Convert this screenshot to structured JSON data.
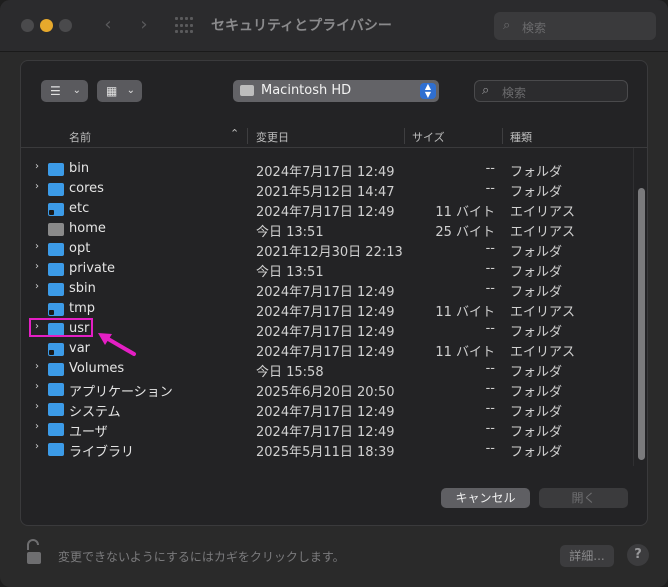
{
  "window": {
    "title": "セキュリティとプライバシー",
    "search_placeholder": "検索",
    "back_icon": "chevron-left-icon",
    "forward_icon": "chevron-right-icon",
    "bottom_text": "変更できないようにするにはカギをクリックします。",
    "detail_button": "詳細...",
    "help_button": "?"
  },
  "sheet": {
    "location": "Macintosh HD",
    "search_placeholder": "検索",
    "columns": {
      "name": "名前",
      "date": "変更日",
      "size": "サイズ",
      "kind": "種類"
    },
    "rows": [
      {
        "name": "bin",
        "date": "2024年7月17日 12:49",
        "size": "--",
        "kind": "フォルダ",
        "disclosure": true,
        "icon": "folder"
      },
      {
        "name": "cores",
        "date": "2021年5月12日 14:47",
        "size": "--",
        "kind": "フォルダ",
        "disclosure": true,
        "icon": "folder"
      },
      {
        "name": "etc",
        "date": "2024年7月17日 12:49",
        "size": "11 バイト",
        "kind": "エイリアス",
        "disclosure": false,
        "icon": "alias"
      },
      {
        "name": "home",
        "date": "今日 13:51",
        "size": "25 バイト",
        "kind": "エイリアス",
        "disclosure": false,
        "icon": "home"
      },
      {
        "name": "opt",
        "date": "2021年12月30日 22:13",
        "size": "--",
        "kind": "フォルダ",
        "disclosure": true,
        "icon": "folder"
      },
      {
        "name": "private",
        "date": "今日 13:51",
        "size": "--",
        "kind": "フォルダ",
        "disclosure": true,
        "icon": "folder"
      },
      {
        "name": "sbin",
        "date": "2024年7月17日 12:49",
        "size": "--",
        "kind": "フォルダ",
        "disclosure": true,
        "icon": "folder"
      },
      {
        "name": "tmp",
        "date": "2024年7月17日 12:49",
        "size": "11 バイト",
        "kind": "エイリアス",
        "disclosure": false,
        "icon": "alias"
      },
      {
        "name": "usr",
        "date": "2024年7月17日 12:49",
        "size": "--",
        "kind": "フォルダ",
        "disclosure": true,
        "icon": "folder"
      },
      {
        "name": "var",
        "date": "2024年7月17日 12:49",
        "size": "11 バイト",
        "kind": "エイリアス",
        "disclosure": false,
        "icon": "alias"
      },
      {
        "name": "Volumes",
        "date": "今日 15:58",
        "size": "--",
        "kind": "フォルダ",
        "disclosure": true,
        "icon": "folder"
      },
      {
        "name": "アプリケーション",
        "date": "2025年6月20日 20:50",
        "size": "--",
        "kind": "フォルダ",
        "disclosure": true,
        "icon": "folder"
      },
      {
        "name": "システム",
        "date": "2024年7月17日 12:49",
        "size": "--",
        "kind": "フォルダ",
        "disclosure": true,
        "icon": "folder"
      },
      {
        "name": "ユーザ",
        "date": "2024年7月17日 12:49",
        "size": "--",
        "kind": "フォルダ",
        "disclosure": true,
        "icon": "folder"
      },
      {
        "name": "ライブラリ",
        "date": "2025年5月11日 18:39",
        "size": "--",
        "kind": "フォルダ",
        "disclosure": true,
        "icon": "folder"
      }
    ],
    "cancel_button": "キャンセル",
    "open_button": "開く"
  },
  "colors": {
    "accent": "#2f6fd1",
    "folder": "#3c9be8",
    "annotation": "#e41fc4",
    "traffic_light_active": "#e7a92c"
  }
}
